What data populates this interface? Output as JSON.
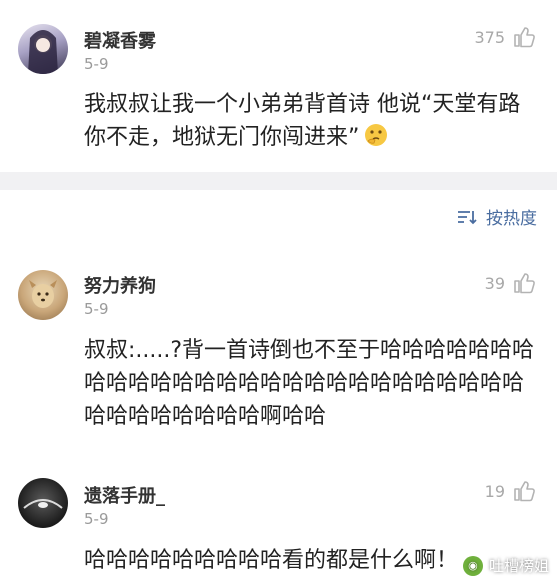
{
  "comments": [
    {
      "username": "碧凝香雾",
      "date": "5-9",
      "likes": "375",
      "text": "我叔叔让我一个小弟弟背首诗 他说“天堂有路你不走，地狱无门你闯进来”",
      "emoji": "thinking-face-icon"
    },
    {
      "username": "努力养狗",
      "date": "5-9",
      "likes": "39",
      "text": "叔叔:.....?背一首诗倒也不至于哈哈哈哈哈哈哈哈哈哈哈哈哈哈哈哈哈哈哈哈哈哈哈哈哈哈哈哈哈哈哈哈哈哈哈啊哈哈"
    },
    {
      "username": "遗落手册_",
      "date": "5-9",
      "likes": "19",
      "text": "哈哈哈哈哈哈哈哈哈看的都是什么啊！"
    }
  ],
  "sort": {
    "label": "按热度"
  },
  "watermark": {
    "label": "吐槽榜姐"
  },
  "colors": {
    "link": "#4a6da0",
    "muted": "#a8a8a8",
    "divider": "#f1f1f3"
  }
}
